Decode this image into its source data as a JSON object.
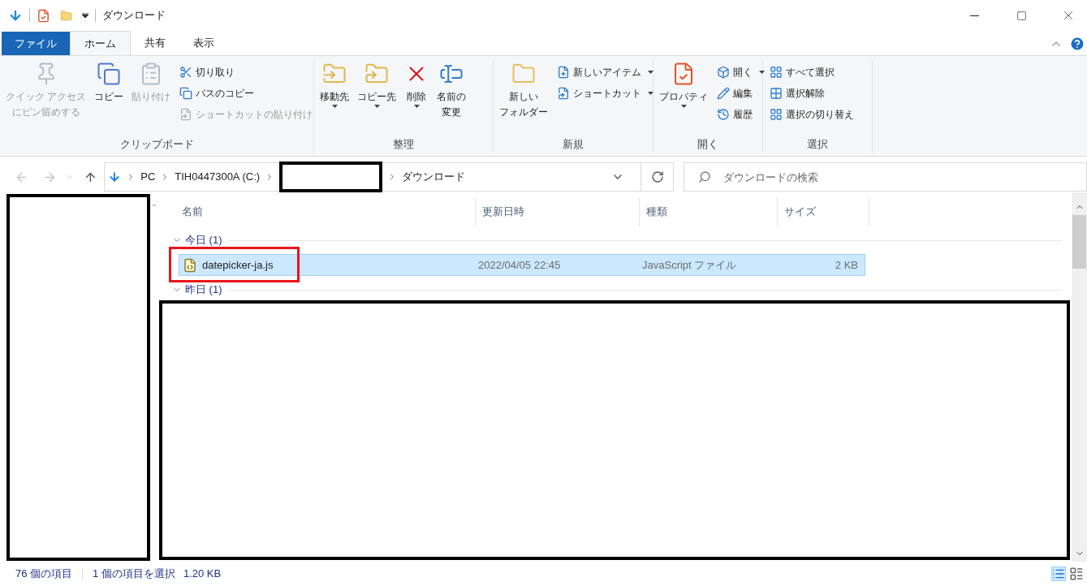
{
  "window": {
    "title": "ダウンロード"
  },
  "ribbon_tabs": [
    {
      "label": "ファイル",
      "kind": "file",
      "selected": false
    },
    {
      "label": "ホーム",
      "kind": "tab",
      "selected": true
    },
    {
      "label": "共有",
      "kind": "tab",
      "selected": false
    },
    {
      "label": "表示",
      "kind": "tab",
      "selected": false
    }
  ],
  "ribbon_groups": [
    {
      "label": "クリップボード",
      "items": [
        {
          "kind": "large",
          "lines": [
            "クイック アクセス",
            "にピン留めする"
          ],
          "disabled": true,
          "dropdown": false
        },
        {
          "kind": "large",
          "lines": [
            "コピー"
          ],
          "disabled": false,
          "dropdown": false
        },
        {
          "kind": "large",
          "lines": [
            "貼り付け"
          ],
          "disabled": true,
          "dropdown": false
        },
        {
          "kind": "stack",
          "items": [
            {
              "label": "切り取り",
              "disabled": false,
              "dropdown": false
            },
            {
              "label": "パスのコピー",
              "disabled": false,
              "dropdown": false
            },
            {
              "label": "ショートカットの貼り付け",
              "disabled": true,
              "dropdown": false
            }
          ]
        }
      ]
    },
    {
      "label": "整理",
      "items": [
        {
          "kind": "large",
          "lines": [
            "移動先"
          ],
          "disabled": false,
          "dropdown": true
        },
        {
          "kind": "large",
          "lines": [
            "コピー先"
          ],
          "disabled": false,
          "dropdown": true
        },
        {
          "kind": "large",
          "lines": [
            "削除"
          ],
          "disabled": false,
          "dropdown": true
        },
        {
          "kind": "large",
          "lines": [
            "名前の",
            "変更"
          ],
          "disabled": false,
          "dropdown": false
        }
      ]
    },
    {
      "label": "新規",
      "items": [
        {
          "kind": "large",
          "lines": [
            "新しい",
            "フォルダー"
          ],
          "disabled": false,
          "dropdown": false
        },
        {
          "kind": "stack",
          "items": [
            {
              "label": "新しいアイテム",
              "disabled": false,
              "dropdown": true
            },
            {
              "label": "ショートカット",
              "disabled": false,
              "dropdown": true
            }
          ]
        }
      ]
    },
    {
      "label": "開く",
      "items": [
        {
          "kind": "large",
          "lines": [
            "プロパティ"
          ],
          "disabled": false,
          "dropdown": true
        },
        {
          "kind": "stack",
          "items": [
            {
              "label": "開く",
              "disabled": false,
              "dropdown": true
            },
            {
              "label": "編集",
              "disabled": false,
              "dropdown": false
            },
            {
              "label": "履歴",
              "disabled": false,
              "dropdown": false
            }
          ]
        }
      ]
    },
    {
      "label": "選択",
      "items": [
        {
          "kind": "stack",
          "items": [
            {
              "label": "すべて選択",
              "disabled": false,
              "dropdown": false
            },
            {
              "label": "選択解除",
              "disabled": false,
              "dropdown": false
            },
            {
              "label": "選択の切り替え",
              "disabled": false,
              "dropdown": false
            }
          ]
        }
      ]
    }
  ],
  "address_bar": {
    "path": [
      {
        "kind": "text",
        "label": "PC"
      },
      {
        "kind": "text",
        "label": "TIH0447300A (C:)"
      },
      {
        "kind": "redacted"
      },
      {
        "kind": "text",
        "label": "ダウンロード"
      }
    ]
  },
  "search": {
    "placeholder": "ダウンロードの検索"
  },
  "file_list": {
    "columns": [
      "名前",
      "更新日時",
      "種類",
      "サイズ"
    ],
    "groups": [
      {
        "label": "今日 (1)",
        "expanded": true,
        "rows": [
          {
            "name": "datepicker-ja.js",
            "modified": "2022/04/05 22:45",
            "type": "JavaScript ファイル",
            "size": "2 KB",
            "selected": true,
            "highlighted": true
          }
        ]
      },
      {
        "label": "昨日 (1)",
        "expanded": true
      }
    ]
  },
  "status_bar": {
    "item_count": "76 個の項目",
    "selection": "1 個の項目を選択",
    "selection_size": "1.20 KB"
  }
}
